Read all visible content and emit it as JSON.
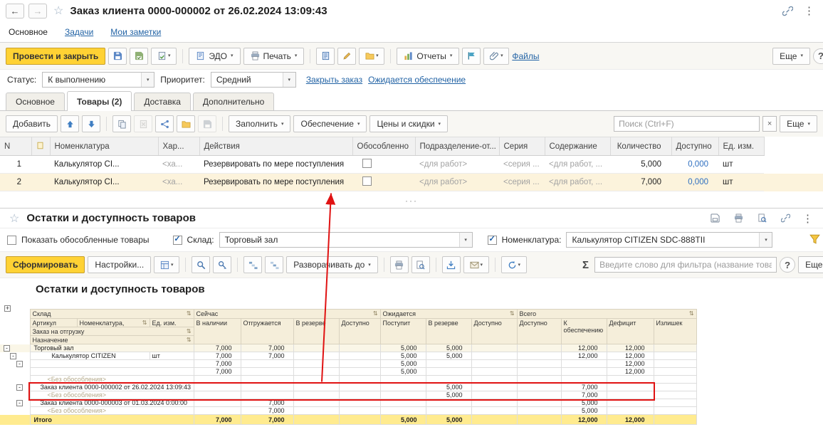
{
  "colors": {
    "primary_button": "#ffd234",
    "link": "#2263a5",
    "selected_row": "#fcf3dc",
    "highlight_cell": "#f1c24b",
    "annotation": "#e01212",
    "available_value": "#2e6fc0",
    "report_header_bg": "#f5eeda",
    "total_row_bg": "#ffeb8f"
  },
  "titlebar": {
    "back": "←",
    "forward": "→",
    "title": "Заказ клиента 0000-000002 от 26.02.2024 13:09:43"
  },
  "nav_tabs": [
    {
      "label": "Основное",
      "active": true
    },
    {
      "label": "Задачи",
      "active": false
    },
    {
      "label": "Мои заметки",
      "active": false
    }
  ],
  "toolbar": {
    "post_and_close": "Провести и закрыть",
    "edo": "ЭДО",
    "print": "Печать",
    "reports": "Отчеты",
    "files": "Файлы",
    "more": "Еще",
    "help": "?"
  },
  "status_row": {
    "status_label": "Статус:",
    "status_value": "К выполнению",
    "priority_label": "Приоритет:",
    "priority_value": "Средний",
    "close_order": "Закрыть заказ",
    "awaiting_supply": "Ожидается обеспечение"
  },
  "doc_tabs": [
    {
      "label": "Основное",
      "active": false
    },
    {
      "label": "Товары (2)",
      "active": true
    },
    {
      "label": "Доставка",
      "active": false
    },
    {
      "label": "Дополнительно",
      "active": false
    }
  ],
  "items_toolbar": {
    "add": "Добавить",
    "fill": "Заполнить",
    "supply": "Обеспечение",
    "prices": "Цены и скидки",
    "search_placeholder": "Поиск (Ctrl+F)",
    "clear": "×",
    "more": "Еще"
  },
  "items_table": {
    "headers": [
      "N",
      "",
      "Номенклатура",
      "Хар...",
      "Действия",
      "Обособленно",
      "Подразделение-от...",
      "Серия",
      "Содержание",
      "Количество",
      "Доступно",
      "Ед. изм."
    ],
    "rows": [
      {
        "n": "1",
        "nomenclature": "Калькулятор CI...",
        "characteristic": "<ха...",
        "action": "Резервировать по мере поступления",
        "department": "<для работ>",
        "series": "<серия ...",
        "content": "<для работ, ...",
        "quantity": "5,000",
        "available": "0,000",
        "unit": "шт",
        "selected": false,
        "action_highlight": false
      },
      {
        "n": "2",
        "nomenclature": "Калькулятор CI...",
        "characteristic": "<ха...",
        "action": "Резервировать по мере поступления",
        "department": "<для работ>",
        "series": "<серия ...",
        "content": "<для работ, ...",
        "quantity": "7,000",
        "available": "0,000",
        "unit": "шт",
        "selected": true,
        "action_highlight": true
      }
    ]
  },
  "splitter": "···",
  "report": {
    "title": "Остатки и доступность товаров",
    "filters": {
      "show_separated": "Показать обособленные товары",
      "warehouse_label": "Склад:",
      "warehouse_value": "Торговый зал",
      "nomenclature_label": "Номенклатура:",
      "nomenclature_value": "Калькулятор CITIZEN SDC-888TII"
    },
    "toolbar": {
      "generate": "Сформировать",
      "settings": "Настройки...",
      "expand_to": "Разворачивать до",
      "sigma": "Σ",
      "filter_placeholder": "Введите слово для фильтра (название товара, покупателя и ...",
      "help": "?",
      "more": "Еще"
    },
    "body_title": "Остатки и доступность товаров",
    "table": {
      "group_headers": [
        {
          "label": "Склад",
          "span": 3
        },
        {
          "label": "Сейчас",
          "span": 4
        },
        {
          "label": "Ожидается",
          "span": 3
        },
        {
          "label": "Всего",
          "span": 4
        }
      ],
      "left_headers": [
        "Артикул",
        "Номенклатура,",
        "Ед. изм."
      ],
      "left_subheaders": [
        "Заказ на отгрузку",
        "Назначение"
      ],
      "columns": [
        "В наличии",
        "Отгружается",
        "В резерве",
        "Доступно",
        "Поступит",
        "В резерве",
        "Доступно",
        "Доступно",
        "К обеспечению",
        "Дефицит",
        "Излишек"
      ],
      "rows": [
        {
          "label": "Торговый зал",
          "style": "group",
          "expander": true,
          "indent": 0,
          "red": false,
          "cells": [
            "7,000",
            "7,000",
            "",
            "",
            "5,000",
            "5,000",
            "",
            "",
            "12,000",
            "12,000",
            ""
          ]
        },
        {
          "label": "Калькулятор CITIZEN",
          "unit": "шт",
          "style": "item",
          "expander": true,
          "indent": 1,
          "red": false,
          "cells": [
            "7,000",
            "7,000",
            "",
            "",
            "5,000",
            "5,000",
            "",
            "",
            "12,000",
            "12,000",
            ""
          ]
        },
        {
          "label": "",
          "style": "plain",
          "expander": true,
          "indent": 2,
          "red": false,
          "cells": [
            "7,000",
            "",
            "",
            "",
            "5,000",
            "",
            "",
            "",
            "",
            "12,000",
            ""
          ]
        },
        {
          "label": "",
          "style": "plain",
          "expander": false,
          "indent": 2,
          "red": false,
          "cells": [
            "7,000",
            "",
            "",
            "",
            "5,000",
            "",
            "",
            "",
            "",
            "12,000",
            ""
          ]
        },
        {
          "label": "<Без обособления>",
          "style": "muted",
          "expander": false,
          "indent": 0,
          "red": false,
          "cells": [
            "",
            "",
            "",
            "",
            "",
            "",
            "",
            "",
            "",
            "",
            ""
          ]
        },
        {
          "label": "Заказ клиента 0000-000002 от 26.02.2024 13:09:43",
          "style": "order",
          "expander": true,
          "indent": 2,
          "red": true,
          "cells": [
            "",
            "",
            "",
            "",
            "",
            "5,000",
            "",
            "",
            "7,000",
            "",
            ""
          ]
        },
        {
          "label": "<Без обособления>",
          "style": "muted",
          "expander": false,
          "indent": 0,
          "red": true,
          "cells": [
            "",
            "",
            "",
            "",
            "",
            "5,000",
            "",
            "",
            "7,000",
            "",
            ""
          ]
        },
        {
          "label": "Заказ клиента 0000-000003 от 01.03.2024 0:00:00",
          "style": "order",
          "expander": true,
          "indent": 2,
          "red": false,
          "cells": [
            "",
            "7,000",
            "",
            "",
            "",
            "",
            "",
            "",
            "5,000",
            "",
            ""
          ]
        },
        {
          "label": "<Без обособления>",
          "style": "muted",
          "expander": false,
          "indent": 0,
          "red": false,
          "cells": [
            "",
            "7,000",
            "",
            "",
            "",
            "",
            "",
            "",
            "5,000",
            "",
            ""
          ]
        },
        {
          "label": "Итого",
          "style": "total",
          "expander": false,
          "indent": 0,
          "red": false,
          "cells": [
            "7,000",
            "7,000",
            "",
            "",
            "5,000",
            "5,000",
            "",
            "",
            "12,000",
            "12,000",
            ""
          ]
        }
      ]
    }
  }
}
